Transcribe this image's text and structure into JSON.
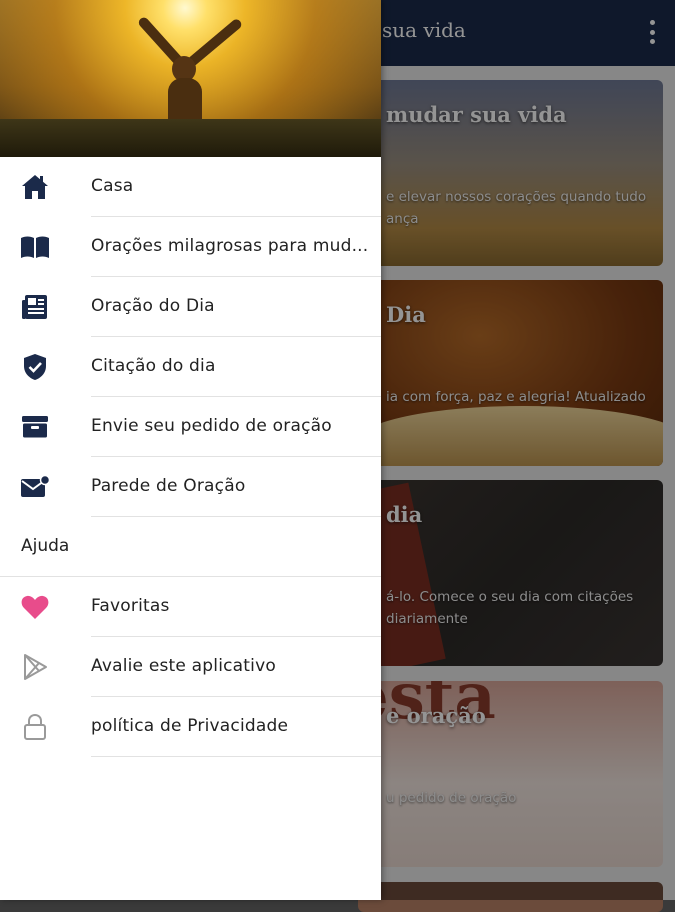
{
  "app": {
    "title": "sua vida",
    "cards": [
      {
        "title": "mudar sua vida",
        "desc": "e elevar nossos corações quando tudo ança"
      },
      {
        "title": "Dia",
        "desc": "ia com força, paz e alegria! Atualizado"
      },
      {
        "title": "dia",
        "desc": "á-lo. Comece o seu dia com citações diariamente"
      },
      {
        "title": "e oração",
        "desc": "u pedido de oração",
        "image_text": "esta"
      }
    ]
  },
  "drawer": {
    "items": [
      {
        "label": "Casa",
        "icon": "home-icon"
      },
      {
        "label": "Orações milagrosas para mud...",
        "icon": "book-icon"
      },
      {
        "label": "Oração do Dia",
        "icon": "newspaper-icon"
      },
      {
        "label": "Citação do dia",
        "icon": "shield-check-icon"
      },
      {
        "label": "Envie seu pedido de oração",
        "icon": "inbox-icon"
      },
      {
        "label": "Parede de Oração",
        "icon": "mail-notification-icon"
      }
    ],
    "section": {
      "label": "Ajuda"
    },
    "help_items": [
      {
        "label": "Favoritas",
        "icon": "heart-icon"
      },
      {
        "label": "Avalie este aplicativo",
        "icon": "play-store-icon"
      },
      {
        "label": "política de Privacidade",
        "icon": "lock-icon"
      }
    ]
  },
  "colors": {
    "appbar": "#1b2a4a",
    "icon_navy": "#1b2a4a",
    "heart": "#e84c8b",
    "outline_gray": "#9a9a9a"
  }
}
